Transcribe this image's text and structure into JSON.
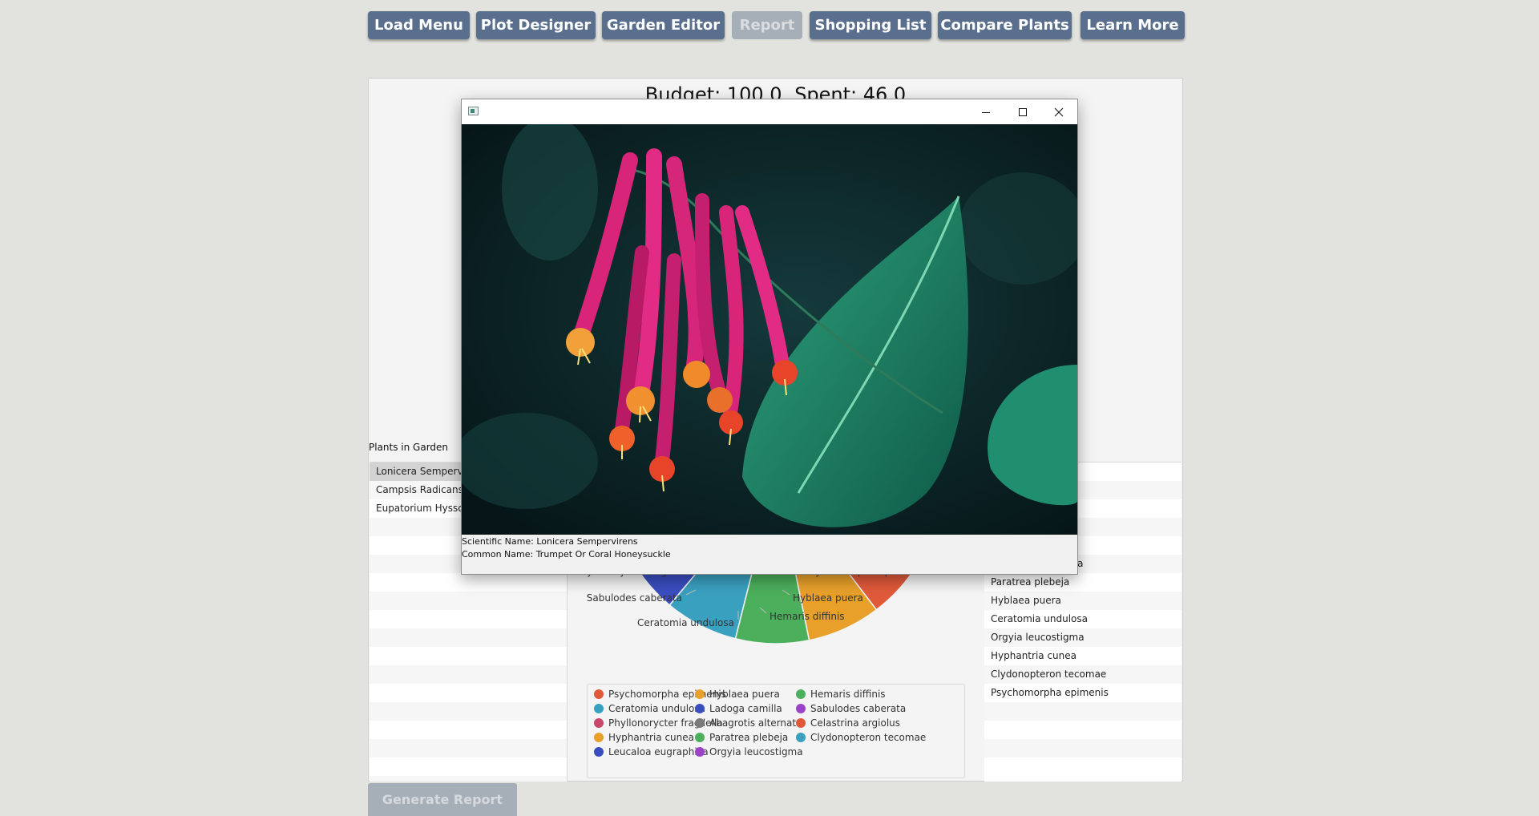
{
  "nav": [
    {
      "label": "Load Menu",
      "enabled": true
    },
    {
      "label": "Plot Designer",
      "enabled": true
    },
    {
      "label": "Garden Editor",
      "enabled": true
    },
    {
      "label": "Report",
      "enabled": false
    },
    {
      "label": "Shopping List",
      "enabled": true
    },
    {
      "label": "Compare Plants",
      "enabled": true
    },
    {
      "label": "Learn More",
      "enabled": true
    }
  ],
  "budget": {
    "text": "Budget: 100.0",
    "spent_text": "Spent: 46.0",
    "budget": 100.0,
    "spent": 46.0
  },
  "plants_label": "Plants in Garden",
  "plants": [
    "Lonicera Sempervirens",
    "Campsis Radicans",
    "Eupatorium Hyssopifolium"
  ],
  "right_list": {
    "partial_text": "lla",
    "items": [
      "Abagrotis alternata",
      "Paratrea plebeja",
      "Hyblaea puera",
      "Ceratomia undulosa",
      "Orgyia leucostigma",
      "Hyphantria cunea",
      "Clydonopteron tecomae",
      "Psychomorpha epimenis"
    ]
  },
  "chart_data": {
    "type": "pie",
    "visible_labels": [
      "Phyllonorycter fragilella",
      "Psychomorpha epimenis",
      "Sabulodes caberata",
      "Hyblaea puera",
      "Hemaris diffinis",
      "Ceratomia undulosa"
    ],
    "slices": [
      {
        "name": "Psychomorpha epimenis",
        "color": "#e05a3a"
      },
      {
        "name": "Hyblaea puera",
        "color": "#e8a02a"
      },
      {
        "name": "Hemaris diffinis",
        "color": "#4caf5c"
      },
      {
        "name": "Ceratomia undulosa",
        "color": "#3aa0c0"
      },
      {
        "name": "Ladoga camilla",
        "color": "#3b4ec0"
      },
      {
        "name": "Sabulodes caberata",
        "color": "#9a42c8"
      },
      {
        "name": "Phyllonorycter fragilella",
        "color": "#c8486a"
      },
      {
        "name": "Abagrotis alternata",
        "color": "#7a7a7a"
      },
      {
        "name": "Celastrina argiolus",
        "color": "#e05a3a"
      },
      {
        "name": "Hyphantria cunea",
        "color": "#e8a02a"
      },
      {
        "name": "Paratrea plebeja",
        "color": "#4caf5c"
      },
      {
        "name": "Clydonopteron tecomae",
        "color": "#3aa0c0"
      },
      {
        "name": "Leucaloa eugraphica",
        "color": "#3b4ec0"
      },
      {
        "name": "Orgyia leucostigma",
        "color": "#9a42c8"
      }
    ]
  },
  "legend": [
    {
      "name": "Psychomorpha epimenis",
      "color": "#e05a3a"
    },
    {
      "name": "Hyblaea puera",
      "color": "#e8a02a"
    },
    {
      "name": "Hemaris diffinis",
      "color": "#4caf5c"
    },
    {
      "name": "Ceratomia undulosa",
      "color": "#3aa0c0"
    },
    {
      "name": "Ladoga camilla",
      "color": "#3b4ec0"
    },
    {
      "name": "Sabulodes caberata",
      "color": "#9a42c8"
    },
    {
      "name": "Phyllonorycter fragilella",
      "color": "#c8486a"
    },
    {
      "name": "Abagrotis alternata",
      "color": "#7a7a7a"
    },
    {
      "name": "Celastrina argiolus",
      "color": "#e05a3a"
    },
    {
      "name": "Hyphantria cunea",
      "color": "#e8a02a"
    },
    {
      "name": "Paratrea plebeja",
      "color": "#4caf5c"
    },
    {
      "name": "Clydonopteron tecomae",
      "color": "#3aa0c0"
    },
    {
      "name": "Leucaloa eugraphica",
      "color": "#3b4ec0"
    },
    {
      "name": "Orgyia leucostigma",
      "color": "#9a42c8"
    }
  ],
  "generate_button": "Generate Report",
  "popup": {
    "scientific_name": "Scientific Name: Lonicera Sempervirens",
    "common_name": "Common Name: Trumpet Or Coral Honeysuckle",
    "controls": [
      "minimize-icon",
      "maximize-icon",
      "close-icon"
    ]
  }
}
